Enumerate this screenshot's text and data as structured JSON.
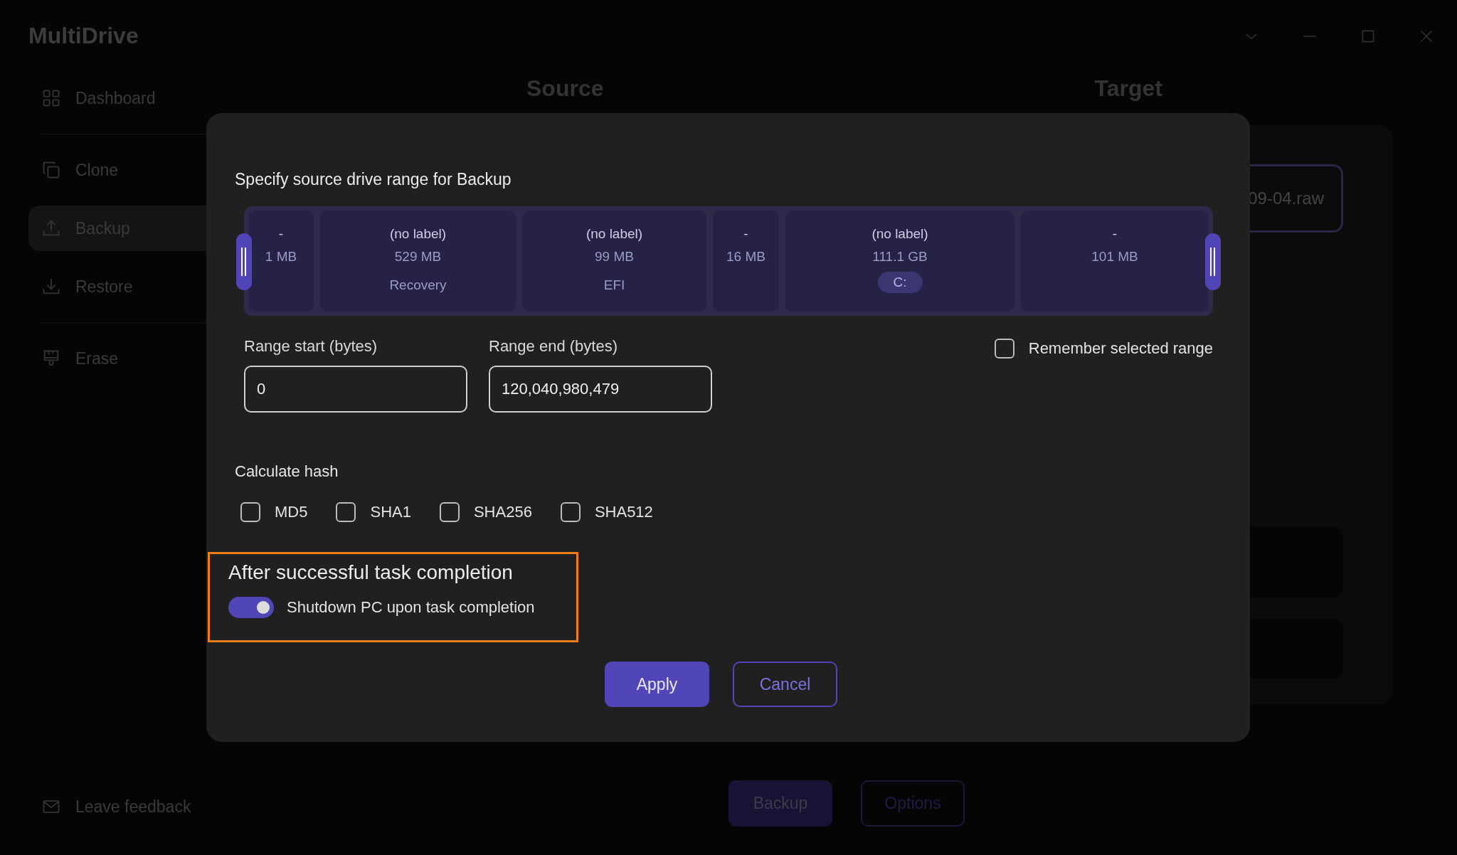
{
  "app": {
    "title": "MultiDrive"
  },
  "sidebar": {
    "items": [
      {
        "label": "Dashboard",
        "kind": "dashboard",
        "selected": false
      },
      {
        "label": "Clone",
        "kind": "clone",
        "selected": false
      },
      {
        "label": "Backup",
        "kind": "backup",
        "selected": true
      },
      {
        "label": "Restore",
        "kind": "restore",
        "selected": false
      },
      {
        "label": "Erase",
        "kind": "erase",
        "selected": false
      }
    ],
    "feedback": "Leave feedback"
  },
  "main": {
    "source_heading": "Source",
    "target_heading": "Target",
    "target_file": "09-04.raw",
    "buttons": [
      "Backup",
      "Options"
    ]
  },
  "dialog": {
    "heading": "Specify source drive range for Backup",
    "partitions": [
      {
        "label": "-",
        "size": "1 MB"
      },
      {
        "label": "(no label)",
        "size": "529 MB",
        "name": "Recovery"
      },
      {
        "label": "(no label)",
        "size": "99 MB",
        "name": "EFI"
      },
      {
        "label": "-",
        "size": "16 MB"
      },
      {
        "label": "(no label)",
        "size": "111.1 GB",
        "drive_letter": "C:"
      },
      {
        "label": "-",
        "size": "101 MB"
      }
    ],
    "range_start": {
      "label": "Range start (bytes)",
      "value": "0"
    },
    "range_end": {
      "label": "Range end (bytes)",
      "value": "120,040,980,479"
    },
    "remember": {
      "label": "Remember selected range",
      "checked": false
    },
    "hash_heading": "Calculate hash",
    "hashes": [
      {
        "label": "MD5",
        "checked": false
      },
      {
        "label": "SHA1",
        "checked": false
      },
      {
        "label": "SHA256",
        "checked": false
      },
      {
        "label": "SHA512",
        "checked": false
      }
    ],
    "completion_heading": "After successful task completion",
    "shutdown": {
      "label": "Shutdown PC upon task completion",
      "on": true
    },
    "buttons": [
      {
        "label": "Apply",
        "kind": "primary"
      },
      {
        "label": "Cancel",
        "kind": "secondary"
      }
    ]
  }
}
